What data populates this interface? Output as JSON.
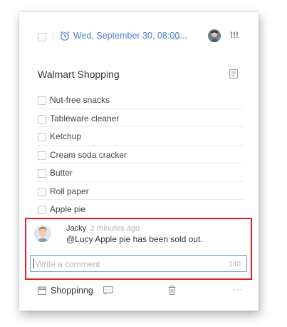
{
  "header": {
    "due_date": "Wed, September 30, 08:00...",
    "priority": "!!!",
    "icons": [
      "checkbox",
      "alarm-clock-icon",
      "repeat-icon",
      "assignee-avatar",
      "priority-icon"
    ]
  },
  "task": {
    "title": "Walmart Shopping",
    "items": [
      {
        "label": "Nut-free snacks",
        "checked": false
      },
      {
        "label": "Tableware cleaner",
        "checked": false
      },
      {
        "label": "Ketchup",
        "checked": false
      },
      {
        "label": "Cream soda cracker",
        "checked": false
      },
      {
        "label": "Butter",
        "checked": false
      },
      {
        "label": "Roll paper",
        "checked": false
      },
      {
        "label": "Apple pie",
        "checked": false
      }
    ]
  },
  "comment": {
    "author": "Jacky",
    "time": "2 minutes ago",
    "text": "@Lucy Apple pie has been sold out."
  },
  "comment_input": {
    "placeholder": "Write a comment",
    "char_limit": "140"
  },
  "footer": {
    "list_name": "Shoppinng",
    "more": "···"
  },
  "colors": {
    "accent": "#4a7fd0",
    "highlight_border": "#e01e1e",
    "input_border": "#6f98d4",
    "text": "#333333",
    "muted": "#b4b4b4"
  }
}
